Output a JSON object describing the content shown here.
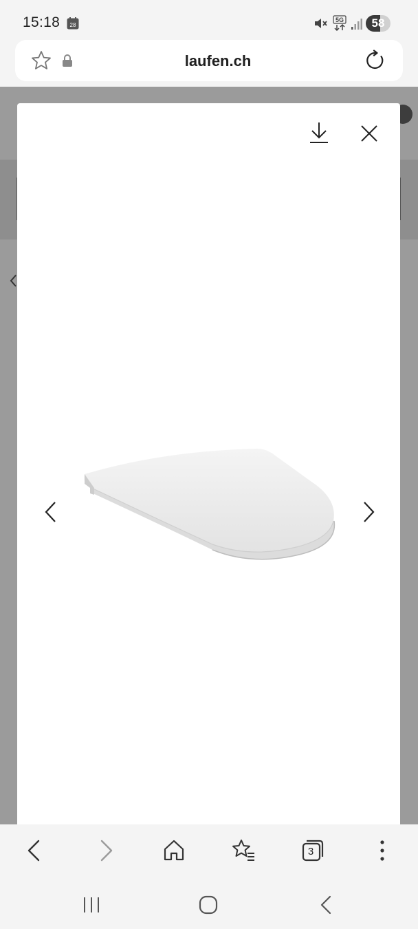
{
  "status_bar": {
    "time": "15:18",
    "calendar_date": "28",
    "network": "5G",
    "battery_level": "58",
    "battery_fraction": 0.58
  },
  "address_bar": {
    "url": "laufen.ch"
  },
  "lightbox": {
    "image_description": "white toilet seat",
    "icons": [
      "download-icon",
      "close-icon",
      "chevron-left-icon",
      "chevron-right-icon"
    ]
  },
  "browser_toolbar": {
    "tab_count": "3",
    "icons": [
      "back-icon",
      "forward-icon",
      "home-icon",
      "bookmarks-icon",
      "tabs-icon",
      "more-icon"
    ]
  },
  "nav_bar": {
    "icons": [
      "recents-icon",
      "home-icon",
      "back-icon"
    ]
  },
  "colors": {
    "overlay": "#9b9b9b",
    "surface": "#ffffff",
    "chrome": "#f4f4f4",
    "icon": "#222222"
  }
}
